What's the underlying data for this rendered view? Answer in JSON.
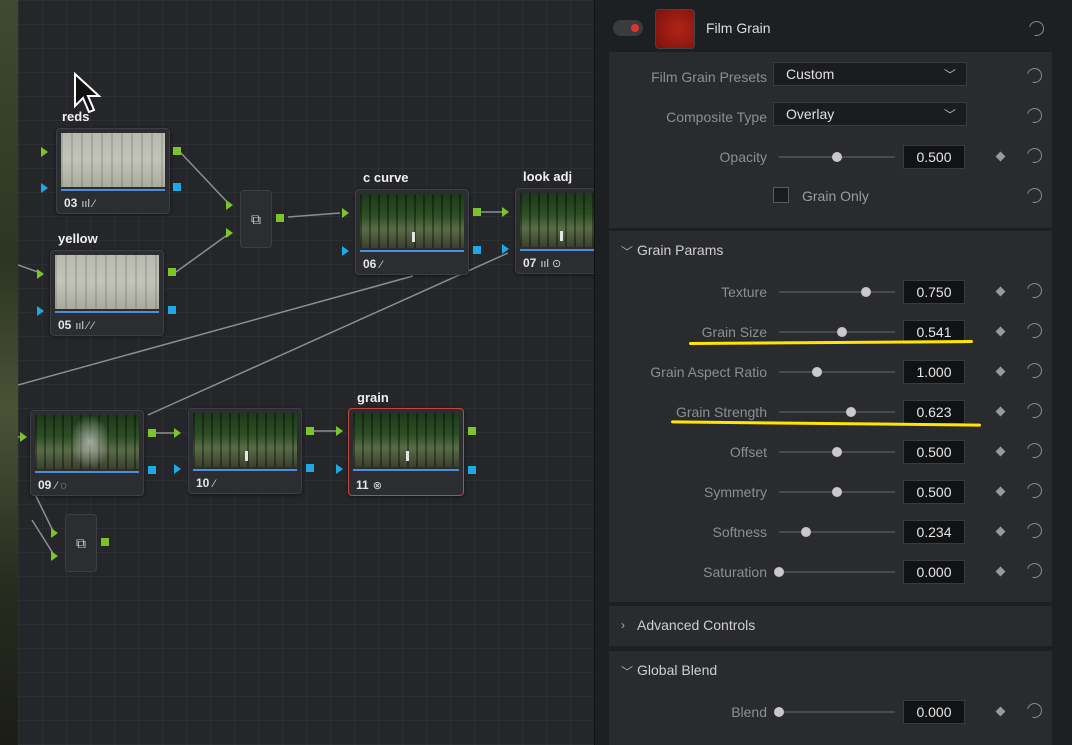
{
  "nodes": {
    "n03": {
      "label": "reds",
      "number": "03",
      "icons": "ııl ⁄"
    },
    "n05": {
      "label": "yellow",
      "number": "05",
      "icons": "ııl ⁄ ⁄"
    },
    "n06": {
      "label": "c curve",
      "number": "06",
      "icons": "⁄"
    },
    "n07": {
      "label": "look adj",
      "number": "07",
      "icons": "ııl ⊙"
    },
    "n09": {
      "number": "09",
      "icons": "⁄ ◌"
    },
    "n10": {
      "number": "10",
      "icons": "⁄"
    },
    "n11": {
      "label": "grain",
      "number": "11",
      "icons": "⊗"
    }
  },
  "inspector": {
    "title": "Film Grain",
    "presets": {
      "label": "Film Grain Presets",
      "value": "Custom"
    },
    "composite": {
      "label": "Composite Type",
      "value": "Overlay"
    },
    "opacity": {
      "label": "Opacity",
      "value": "0.500",
      "level": 0.5
    },
    "grain_only": {
      "label": "Grain Only"
    },
    "sections": {
      "grain_params": "Grain Params",
      "advanced": "Advanced Controls",
      "global_blend": "Global Blend"
    },
    "params": [
      {
        "label": "Texture",
        "value": "0.750",
        "level": 0.75
      },
      {
        "label": "Grain Size",
        "value": "0.541",
        "level": 0.541
      },
      {
        "label": "Grain Aspect Ratio",
        "value": "1.000",
        "level": 0.33
      },
      {
        "label": "Grain Strength",
        "value": "0.623",
        "level": 0.623
      },
      {
        "label": "Offset",
        "value": "0.500",
        "level": 0.5
      },
      {
        "label": "Symmetry",
        "value": "0.500",
        "level": 0.5
      },
      {
        "label": "Softness",
        "value": "0.234",
        "level": 0.234
      },
      {
        "label": "Saturation",
        "value": "0.000",
        "level": 0.0
      }
    ],
    "blend": {
      "label": "Blend",
      "value": "0.000",
      "level": 0.0
    }
  },
  "colors": {
    "highlight": "#ffe500",
    "selected_node": "#c7463e",
    "green_pin": "#7bc42c",
    "blue_pin": "#1fa8e6"
  }
}
